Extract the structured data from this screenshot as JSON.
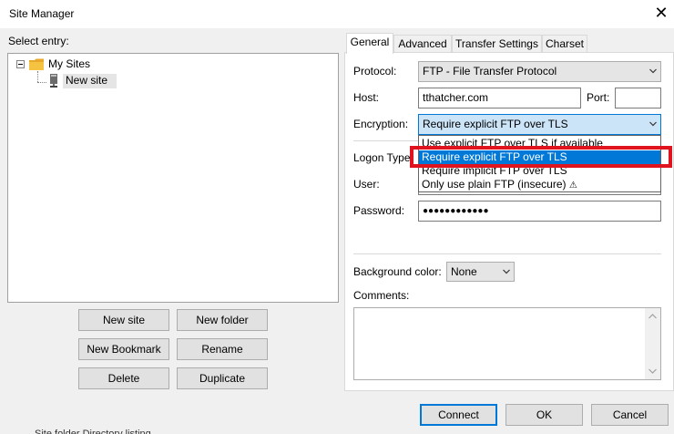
{
  "window": {
    "title": "Site Manager",
    "close_glyph": "✕"
  },
  "left": {
    "select_entry_label": "Select entry:",
    "tree": {
      "root_label": "My Sites",
      "child_label": "New site"
    },
    "buttons": {
      "new_site": "New site",
      "new_folder": "New folder",
      "new_bookmark": "New Bookmark",
      "rename": "Rename",
      "delete": "Delete",
      "duplicate": "Duplicate"
    }
  },
  "tabs": [
    {
      "label": "General"
    },
    {
      "label": "Advanced"
    },
    {
      "label": "Transfer Settings"
    },
    {
      "label": "Charset"
    }
  ],
  "general": {
    "protocol_label": "Protocol:",
    "protocol_value": "FTP - File Transfer Protocol",
    "host_label": "Host:",
    "host_value": "tthatcher.com",
    "port_label": "Port:",
    "port_value": "",
    "encryption_label": "Encryption:",
    "encryption_value": "Require explicit FTP over TLS",
    "encryption_options": [
      "Use explicit FTP over TLS if available",
      "Require explicit FTP over TLS",
      "Require implicit FTP over TLS",
      "Only use plain FTP (insecure)"
    ],
    "warning_glyph": "⚠",
    "logon_type_label": "Logon Type:",
    "user_label": "User:",
    "password_label": "Password:",
    "password_mask": "●●●●●●●●●●●●",
    "background_color_label": "Background color:",
    "background_color_value": "None",
    "comments_label": "Comments:"
  },
  "footer": {
    "connect": "Connect",
    "ok": "OK",
    "cancel": "Cancel",
    "clipped_text": "Site folder                    Directory listing"
  },
  "colors": {
    "accent": "#0078d7",
    "highlight_red": "#e0141e",
    "folder_yellow": "#f5c242"
  }
}
